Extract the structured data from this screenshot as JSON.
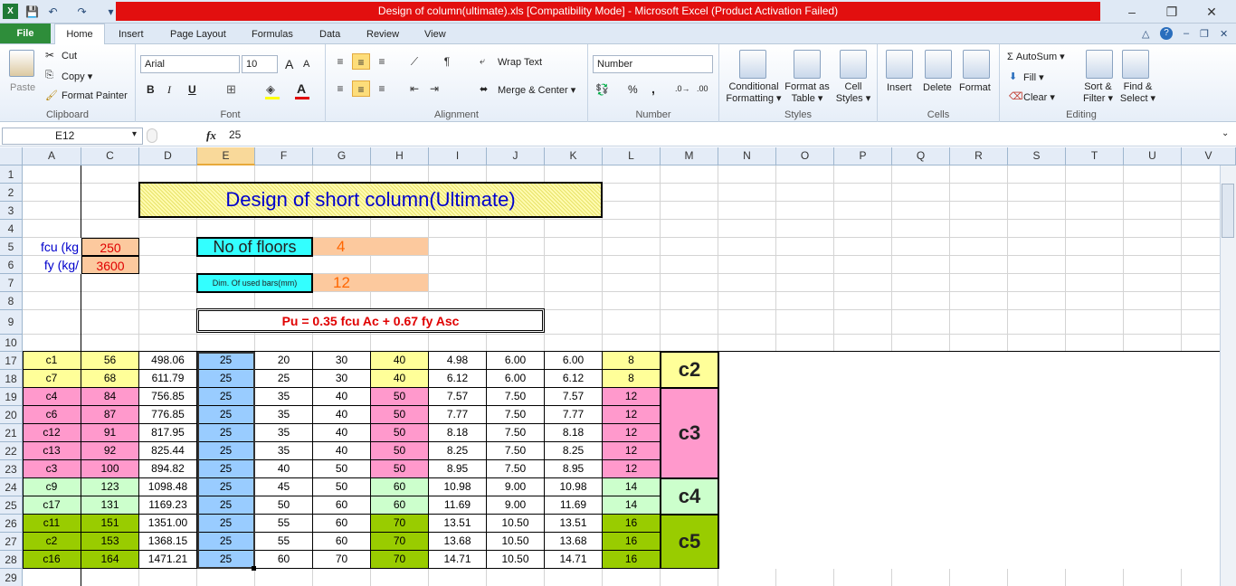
{
  "window": {
    "title": "Design of column(ultimate).xls  [Compatibility Mode]  -  Microsoft Excel (Product Activation Failed)",
    "minimize": "–",
    "restore": "❐",
    "close": "✕"
  },
  "tabs": {
    "file": "File",
    "items": [
      "Home",
      "Insert",
      "Page Layout",
      "Formulas",
      "Data",
      "Review",
      "View"
    ]
  },
  "ribbon": {
    "clipboard": {
      "paste": "Paste",
      "cut": "Cut",
      "copy": "Copy ▾",
      "painter": "Format Painter",
      "label": "Clipboard"
    },
    "font": {
      "name": "Arial",
      "size": "10",
      "label": "Font",
      "bold": "B",
      "italic": "I",
      "underline": "U"
    },
    "alignment": {
      "wrap": "Wrap Text",
      "merge": "Merge & Center ▾",
      "label": "Alignment"
    },
    "number": {
      "format": "Number",
      "label": "Number",
      "percent": "%",
      "comma": ","
    },
    "styles": {
      "conditional": "Conditional Formatting ▾",
      "table": "Format as Table ▾",
      "cell": "Cell Styles ▾",
      "label": "Styles"
    },
    "cells": {
      "insert": "Insert",
      "delete": "Delete",
      "format": "Format",
      "label": "Cells"
    },
    "editing": {
      "autosum": "Σ AutoSum ▾",
      "fill": "Fill ▾",
      "clear": "Clear ▾",
      "sort": "Sort & Filter ▾",
      "find": "Find & Select ▾",
      "label": "Editing"
    }
  },
  "formula_bar": {
    "name_box": "E12",
    "fx": "fx",
    "value": "25"
  },
  "columns": [
    "A",
    "C",
    "D",
    "E",
    "F",
    "G",
    "H",
    "I",
    "J",
    "K",
    "L",
    "M",
    "N",
    "O",
    "P",
    "Q",
    "R",
    "S",
    "T",
    "U",
    "V"
  ],
  "sheet": {
    "title": "Design of short column(Ultimate)",
    "fcu_label": "fcu (kg",
    "fcu_value": "250",
    "fy_label": "fy (kg/",
    "fy_value": "3600",
    "floors_label": "No of floors",
    "floors_value": "4",
    "bars_label": "Dim. Of used bars(mm)",
    "bars_value": "12",
    "formula": "Pu = 0.35 fcu Ac + 0.67 fy Asc"
  },
  "top_rows": [
    "1",
    "2",
    "3",
    "4",
    "5",
    "6",
    "7",
    "8",
    "9",
    "10"
  ],
  "table": [
    {
      "row": "17",
      "vals": [
        "c1",
        "56",
        "498.06",
        "25",
        "20",
        "30",
        "40",
        "4.98",
        "6.00",
        "6.00",
        "8"
      ]
    },
    {
      "row": "18",
      "vals": [
        "c7",
        "68",
        "611.79",
        "25",
        "25",
        "30",
        "40",
        "6.12",
        "6.00",
        "6.12",
        "8"
      ]
    },
    {
      "row": "19",
      "vals": [
        "c4",
        "84",
        "756.85",
        "25",
        "35",
        "40",
        "50",
        "7.57",
        "7.50",
        "7.57",
        "12"
      ]
    },
    {
      "row": "20",
      "vals": [
        "c6",
        "87",
        "776.85",
        "25",
        "35",
        "40",
        "50",
        "7.77",
        "7.50",
        "7.77",
        "12"
      ]
    },
    {
      "row": "21",
      "vals": [
        "c12",
        "91",
        "817.95",
        "25",
        "35",
        "40",
        "50",
        "8.18",
        "7.50",
        "8.18",
        "12"
      ]
    },
    {
      "row": "22",
      "vals": [
        "c13",
        "92",
        "825.44",
        "25",
        "35",
        "40",
        "50",
        "8.25",
        "7.50",
        "8.25",
        "12"
      ]
    },
    {
      "row": "23",
      "vals": [
        "c3",
        "100",
        "894.82",
        "25",
        "40",
        "50",
        "50",
        "8.95",
        "7.50",
        "8.95",
        "12"
      ]
    },
    {
      "row": "24",
      "vals": [
        "c9",
        "123",
        "1098.48",
        "25",
        "45",
        "50",
        "60",
        "10.98",
        "9.00",
        "10.98",
        "14"
      ]
    },
    {
      "row": "25",
      "vals": [
        "c17",
        "131",
        "1169.23",
        "25",
        "50",
        "60",
        "60",
        "11.69",
        "9.00",
        "11.69",
        "14"
      ]
    },
    {
      "row": "26",
      "vals": [
        "c11",
        "151",
        "1351.00",
        "25",
        "55",
        "60",
        "70",
        "13.51",
        "10.50",
        "13.51",
        "16"
      ]
    },
    {
      "row": "27",
      "vals": [
        "c2",
        "153",
        "1368.15",
        "25",
        "55",
        "60",
        "70",
        "13.68",
        "10.50",
        "13.68",
        "16"
      ]
    },
    {
      "row": "28",
      "vals": [
        "c16",
        "164",
        "1471.21",
        "25",
        "60",
        "70",
        "70",
        "14.71",
        "10.50",
        "14.71",
        "16"
      ]
    }
  ],
  "last_row": "29",
  "groups": [
    {
      "label": "c2",
      "color": "#ffff99"
    },
    {
      "label": "c3",
      "color": "#ff99cc"
    },
    {
      "label": "c4",
      "color": "#ccffcc"
    },
    {
      "label": "c5",
      "color": "#99cc00"
    }
  ],
  "colors": {
    "yellow": "#ffff99",
    "pink": "#ff99cc",
    "lightgreen": "#ccffcc",
    "green": "#99cc00",
    "blue": "#99ccff",
    "peach": "#fcc99e",
    "cyan": "#33ffff",
    "red_text": "#e00000",
    "blue_text": "#0000cc",
    "orange_text": "#ff6600"
  }
}
